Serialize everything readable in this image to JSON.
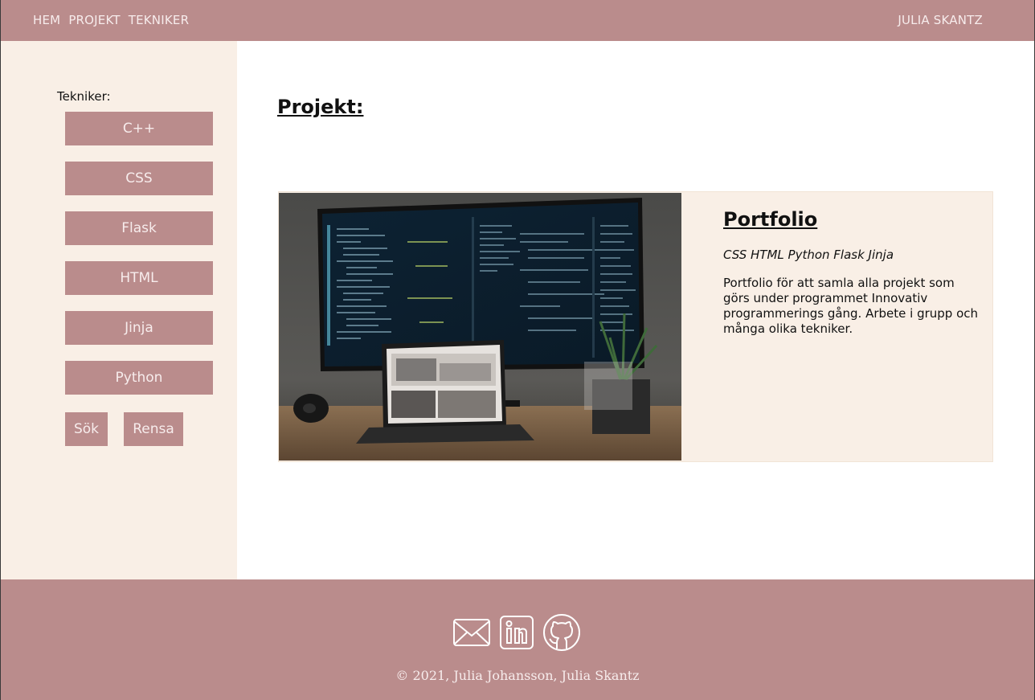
{
  "nav": {
    "links": [
      "HEM",
      "PROJEKT",
      "TEKNIKER"
    ],
    "user": "JULIA SKANTZ"
  },
  "sidebar": {
    "title": "Tekniker:",
    "techniques": [
      "C++",
      "CSS",
      "Flask",
      "HTML",
      "Jinja",
      "Python"
    ],
    "search_label": "Sök",
    "clear_label": "Rensa"
  },
  "main": {
    "title": "Projekt:",
    "projects": [
      {
        "title": "Portfolio",
        "tags": "CSS HTML Python Flask Jinja",
        "description": "Portfolio för att samla alla projekt som görs under programmet Innovativ programmerings gång. Arbete i grupp och många olika tekniker.",
        "image": "laptop-and-monitor-photo"
      }
    ]
  },
  "footer": {
    "icons": [
      "mail-icon",
      "linkedin-icon",
      "github-icon"
    ],
    "copyright": "© 2021, Julia Johansson, Julia Skantz"
  },
  "colors": {
    "brand": "#ba8c8c",
    "sidebar_bg": "#f9efe6",
    "light_text": "#f7ecec"
  }
}
